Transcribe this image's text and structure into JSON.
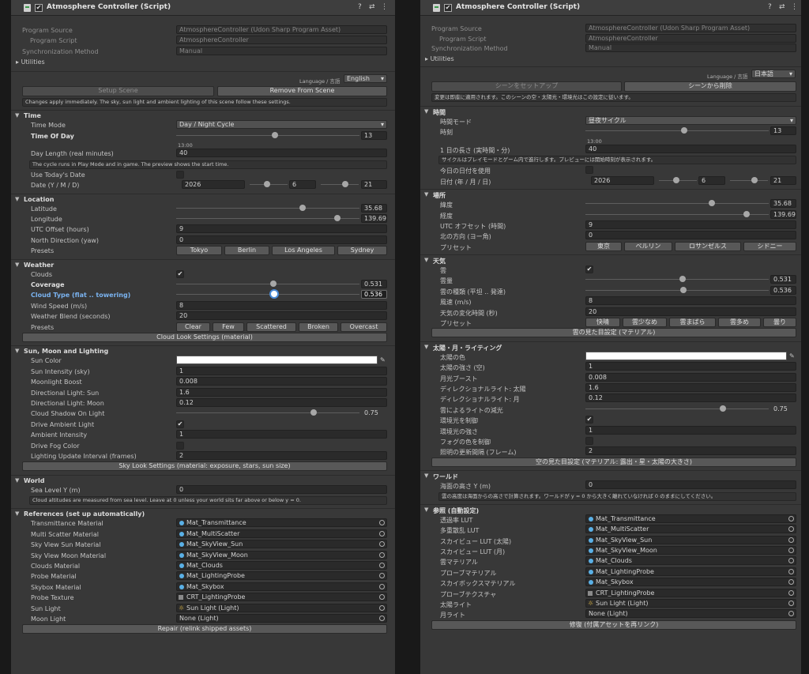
{
  "left": {
    "header": {
      "title": "Atmosphere Controller (Script)",
      "help": "?",
      "settings": "⇄",
      "menu": "⋮"
    },
    "script": {
      "program_source_label": "Program Source",
      "program_source_value": "AtmosphereController (Udon Sharp Program Asset)",
      "program_script_label": "Program Script",
      "program_script_value": "AtmosphereController",
      "sync_label": "Synchronization Method",
      "sync_value": "Manual",
      "utilities": "Utilities"
    },
    "language": {
      "label": "Language / 言語",
      "value": "English"
    },
    "setup": {
      "setup_label": "Setup Scene",
      "remove_label": "Remove From Scene",
      "info": "Changes apply immediately. The sky, sun light and ambient lighting of this scene follow these settings."
    },
    "time": {
      "title": "Time",
      "mode_label": "Time Mode",
      "mode_value": "Day / Night Cycle",
      "tod_label": "Time Of Day",
      "tod_value": "13",
      "tod_fraction": 0.54,
      "clock": "13:00",
      "day_length_label": "Day Length (real minutes)",
      "day_length_value": "40",
      "day_help": "The cycle runs in Play Mode and in game. The preview shows the start time.",
      "use_today_label": "Use Today's Date",
      "date_label": "Date (Y / M / D)",
      "year": "2026",
      "month": "6",
      "month_fraction": 0.45,
      "day": "21",
      "day_fraction": 0.65
    },
    "location": {
      "title": "Location",
      "lat_label": "Latitude",
      "lat_value": "35.68",
      "lat_fraction": 0.7,
      "lon_label": "Longitude",
      "lon_value": "139.69",
      "lon_fraction": 0.88,
      "utc_label": "UTC Offset (hours)",
      "utc_value": "9",
      "north_label": "North Direction (yaw)",
      "north_value": "0",
      "presets_label": "Presets",
      "presets": [
        "Tokyo",
        "Berlin",
        "Los Angeles",
        "Sydney"
      ]
    },
    "weather": {
      "title": "Weather",
      "clouds_label": "Clouds",
      "coverage_label": "Coverage",
      "coverage_value": "0.531",
      "cloud_type_label": "Cloud Type (flat .. towering)",
      "cloud_type_value": "0.536",
      "wind_label": "Wind Speed (m/s)",
      "wind_value": "8",
      "blend_label": "Weather Blend (seconds)",
      "blend_value": "20",
      "presets_label": "Presets",
      "presets": [
        "Clear",
        "Few",
        "Scattered",
        "Broken",
        "Overcast"
      ],
      "look_button": "Cloud Look Settings (material)"
    },
    "sun": {
      "title": "Sun, Moon and Lighting",
      "color_label": "Sun Color",
      "intensity_label": "Sun Intensity (sky)",
      "intensity_value": "1",
      "moon_boost_label": "Moonlight Boost",
      "moon_boost_value": "0.008",
      "dl_sun_label": "Directional Light: Sun",
      "dl_sun_value": "1.6",
      "dl_moon_label": "Directional Light: Moon",
      "dl_moon_value": "0.12",
      "shadow_label": "Cloud Shadow On Light",
      "shadow_value": "0.75",
      "drive_ambient_label": "Drive Ambient Light",
      "ambient_intensity_label": "Ambient Intensity",
      "ambient_intensity_value": "1",
      "drive_fog_label": "Drive Fog Color",
      "interval_label": "Lighting Update Interval (frames)",
      "interval_value": "2",
      "sky_button": "Sky Look Settings (material: exposure, stars, sun size)"
    },
    "world": {
      "title": "World",
      "sea_label": "Sea Level Y (m)",
      "sea_value": "0",
      "help": "Cloud altitudes are measured from sea level. Leave at 0 unless your world sits far above or below y = 0."
    },
    "refs": {
      "title": "References (set up automatically)",
      "items": [
        {
          "label": "Transmittance Material",
          "value": "Mat_Transmittance"
        },
        {
          "label": "Multi Scatter Material",
          "value": "Mat_MultiScatter"
        },
        {
          "label": "Sky View Sun Material",
          "value": "Mat_SkyView_Sun"
        },
        {
          "label": "Sky View Moon Material",
          "value": "Mat_SkyView_Moon"
        },
        {
          "label": "Clouds Material",
          "value": "Mat_Clouds"
        },
        {
          "label": "Probe Material",
          "value": "Mat_LightingProbe"
        },
        {
          "label": "Skybox Material",
          "value": "Mat_Skybox"
        },
        {
          "label": "Probe Texture",
          "value": "CRT_LightingProbe"
        },
        {
          "label": "Sun Light",
          "value": "Sun Light (Light)"
        },
        {
          "label": "Moon Light",
          "value": "None (Light)"
        }
      ],
      "repair": "Repair (relink shipped assets)"
    }
  },
  "right": {
    "header": {
      "title": "Atmosphere Controller (Script)",
      "help": "?",
      "settings": "⇄",
      "menu": "⋮"
    },
    "script": {
      "program_source_label": "Program Source",
      "program_source_value": "AtmosphereController (Udon Sharp Program Asset)",
      "program_script_label": "Program Script",
      "program_script_value": "AtmosphereController",
      "sync_label": "Synchronization Method",
      "sync_value": "Manual",
      "utilities": "Utilities"
    },
    "language": {
      "label": "Language / 言語",
      "value": "日本語"
    },
    "setup": {
      "setup_label": "シーンをセットアップ",
      "remove_label": "シーンから削除",
      "info": "変更は即座に適用されます。このシーンの空・太陽光・環境光はこの設定に従います。"
    },
    "time": {
      "title": "時間",
      "mode_label": "時間モード",
      "mode_value": "昼夜サイクル",
      "tod_label": "時刻",
      "tod_value": "13",
      "clock": "13:00",
      "day_length_label": "1 日の長さ (実時間・分)",
      "day_length_value": "40",
      "day_help": "サイクルはプレイモードとゲーム内で進行します。プレビューには開始時刻が表示されます。",
      "use_today_label": "今日の日付を使用",
      "date_label": "日付 (年 / 月 / 日)",
      "year": "2026",
      "month": "6",
      "day": "21"
    },
    "location": {
      "title": "場所",
      "lat_label": "緯度",
      "lat_value": "35.68",
      "lon_label": "経度",
      "lon_value": "139.69",
      "utc_label": "UTC オフセット (時間)",
      "utc_value": "9",
      "north_label": "北の方向 (ヨー角)",
      "north_value": "0",
      "presets_label": "プリセット",
      "presets": [
        "東京",
        "ベルリン",
        "ロサンゼルス",
        "シドニー"
      ]
    },
    "weather": {
      "title": "天気",
      "clouds_label": "雲",
      "coverage_label": "雲量",
      "coverage_value": "0.531",
      "cloud_type_label": "雲の種類 (平坦 .. 発達)",
      "cloud_type_value": "0.536",
      "wind_label": "風速 (m/s)",
      "wind_value": "8",
      "blend_label": "天気の変化時間 (秒)",
      "blend_value": "20",
      "presets_label": "プリセット",
      "presets": [
        "快晴",
        "雲少なめ",
        "雲まばら",
        "雲多め",
        "曇り"
      ],
      "look_button": "雲の見た目設定 (マテリアル)"
    },
    "sun": {
      "title": "太陽・月・ライティング",
      "color_label": "太陽の色",
      "intensity_label": "太陽の強さ (空)",
      "intensity_value": "1",
      "moon_boost_label": "月光ブースト",
      "moon_boost_value": "0.008",
      "dl_sun_label": "ディレクショナルライト: 太陽",
      "dl_sun_value": "1.6",
      "dl_moon_label": "ディレクショナルライト: 月",
      "dl_moon_value": "0.12",
      "shadow_label": "雲によるライトの減光",
      "shadow_value": "0.75",
      "drive_ambient_label": "環境光を制御",
      "ambient_intensity_label": "環境光の強さ",
      "ambient_intensity_value": "1",
      "drive_fog_label": "フォグの色を制御",
      "interval_label": "照明の更新間隔 (フレーム)",
      "interval_value": "2",
      "sky_button": "空の見た目設定 (マテリアル: 露出・星・太陽の大きさ)"
    },
    "world": {
      "title": "ワールド",
      "sea_label": "海面の高さ Y (m)",
      "sea_value": "0",
      "help": "雲の高度は海面からの高さで計算されます。ワールドが y = 0 から大きく離れていなければ 0 のままにしてください。"
    },
    "refs": {
      "title": "参照 (自動設定)",
      "items": [
        {
          "label": "透過率 LUT",
          "value": "Mat_Transmittance"
        },
        {
          "label": "多重散乱 LUT",
          "value": "Mat_MultiScatter"
        },
        {
          "label": "スカイビュー LUT (太陽)",
          "value": "Mat_SkyView_Sun"
        },
        {
          "label": "スカイビュー LUT (月)",
          "value": "Mat_SkyView_Moon"
        },
        {
          "label": "雲マテリアル",
          "value": "Mat_Clouds"
        },
        {
          "label": "プローブマテリアル",
          "value": "Mat_LightingProbe"
        },
        {
          "label": "スカイボックスマテリアル",
          "value": "Mat_Skybox"
        },
        {
          "label": "プローブテクスチャ",
          "value": "CRT_LightingProbe"
        },
        {
          "label": "太陽ライト",
          "value": "Sun Light (Light)"
        },
        {
          "label": "月ライト",
          "value": "None (Light)"
        }
      ],
      "repair": "修復 (付属アセットを再リンク)"
    }
  },
  "check_glyph": "✔",
  "icon_names": {
    "script": "script-icon",
    "material": "material-dot-icon",
    "light": "sun-icon",
    "texture": "texture-icon",
    "picker": "object-picker-icon",
    "eyedropper": "eyedropper-icon"
  }
}
